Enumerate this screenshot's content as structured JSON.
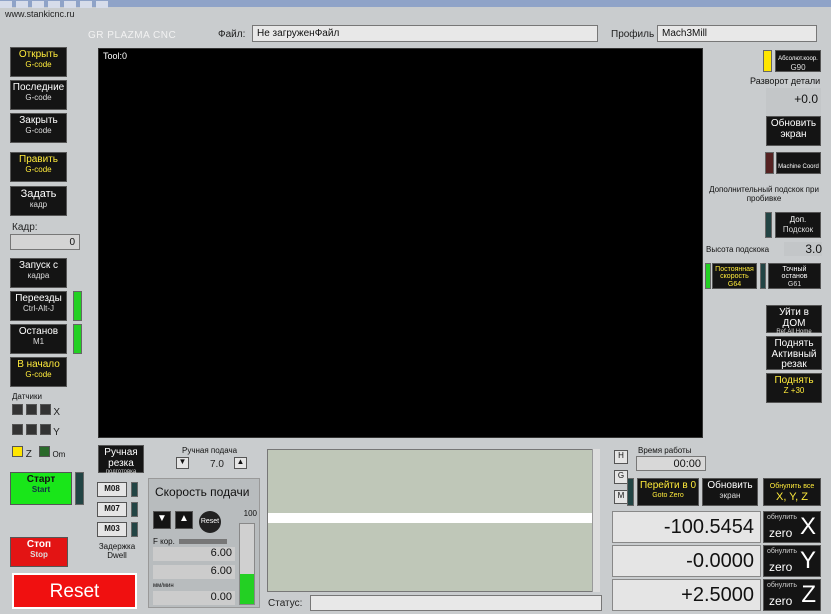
{
  "site": "www.stankicnc.ru",
  "brand": "GR PLAZMA  CNC",
  "file_label": "Файл:",
  "file_value": "Не загруженФайл",
  "profile_label": "Профиль",
  "profile_value": "Mach3Mill",
  "tool_label": "Tool:0",
  "left": {
    "open": {
      "main": "Открыть",
      "sub": "G-code"
    },
    "recent": {
      "main": "Последние",
      "sub": "G-code"
    },
    "close": {
      "main": "Закрыть",
      "sub": "G-code"
    },
    "edit": {
      "main": "Править",
      "sub": "G-code"
    },
    "set_line": {
      "main": "Задать",
      "sub": "кадр"
    },
    "line_label": "Кадр:",
    "line_value": "0",
    "run_from": {
      "main": "Запуск с",
      "sub": "кадра"
    },
    "jumps": {
      "main": "Переезды",
      "sub": "Ctrl-Alt-J"
    },
    "stop_m1": {
      "main": "Останов",
      "sub": "M1"
    },
    "to_start": {
      "main": "В начало",
      "sub": "G-code"
    },
    "sensors_label": "Датчики",
    "x": "X",
    "y": "Y",
    "z": "Z",
    "om": "Om"
  },
  "right": {
    "abs_coord": {
      "main": "Абсолют.коор.",
      "sub": "G90"
    },
    "rotation_label": "Разворот детали",
    "rotation_value": "+0.0",
    "refresh": {
      "main": "Обновить",
      "sub": "экран"
    },
    "machine_coord": "Machine Coord",
    "extra_pierce_label": "Дополнительный подскок при пробивке",
    "extra_pierce_btn": {
      "main": "Доп.",
      "sub": "Подскок"
    },
    "pierce_height_label": "Высота подскока",
    "pierce_height_value": "3.0",
    "const_speed": {
      "main": "Постоянная скорость",
      "sub": "G64"
    },
    "exact_stop": {
      "main": "Точный останов",
      "sub": "G61"
    },
    "go_home": {
      "main": "Уйти в ДОМ",
      "sub": "Ref.All Home"
    },
    "raise_active": "Поднять Активный резак",
    "raise30": {
      "main": "Поднять",
      "sub": "Z  +30"
    }
  },
  "bottom": {
    "manual_cut": {
      "main": "Ручная резка",
      "sub": "подготовка"
    },
    "manual_feed_label": "Ручная подача",
    "manual_feed_value": "7.0",
    "m08": "M08",
    "m07": "M07",
    "m03": "M03",
    "feed_title": "Скорость подачи",
    "reset_small": "Reset",
    "feed_pct": "100",
    "f_kor": "F кор.",
    "f_kor_value": "6.00",
    "f_label": "F",
    "f_value": "6.00",
    "mm_min": "мм/мин",
    "feed_actual": "0.00",
    "start": {
      "main": "Старт",
      "sub": "Start"
    },
    "stop": {
      "main": "Стоп",
      "sub": "Stop"
    },
    "dwell": {
      "main": "Задержка",
      "sub": "Dwell"
    },
    "reset": "Reset",
    "status_label": "Статус:",
    "status_value": "",
    "h": "H",
    "g": "G",
    "m": "M",
    "work_time_label": "Время работы",
    "work_time_value": "00:00",
    "goto_zero": {
      "main": "Перейти в 0",
      "sub": "Goto Zero"
    },
    "refresh_screen": {
      "main": "Обновить",
      "sub": "экран"
    },
    "zero_all": {
      "main": "Обнулить все",
      "sub": "X, Y, Z"
    },
    "x_value": "-100.5454",
    "y_value": "-0.0000",
    "z_value": "+2.5000",
    "zero_top": "обнулить",
    "zero_bottom": "zero",
    "ax_x": "X",
    "ax_y": "Y",
    "ax_z": "Z"
  },
  "colors": {
    "led_green": "#23d023",
    "led_yellow": "#ffe600",
    "start_green": "#19e619",
    "stop_red": "#e31414",
    "reset_red": "#f01010"
  }
}
